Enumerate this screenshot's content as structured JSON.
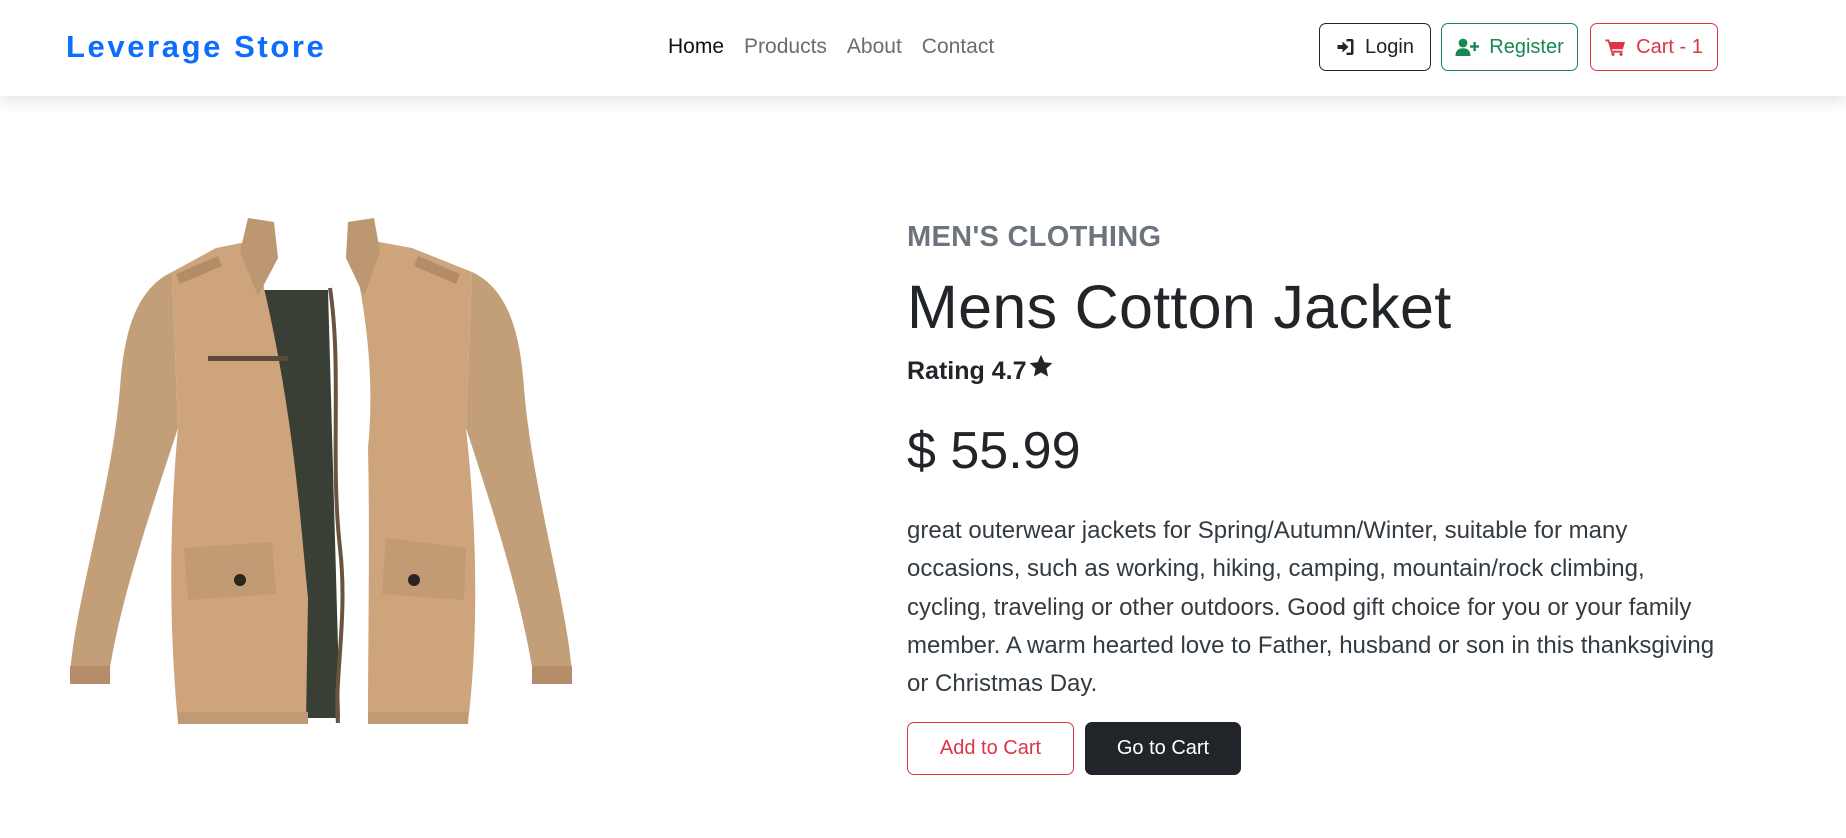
{
  "navbar": {
    "brand": "Leverage Store",
    "links": [
      {
        "label": "Home",
        "active": true
      },
      {
        "label": "Products",
        "active": false
      },
      {
        "label": "About",
        "active": false
      },
      {
        "label": "Contact",
        "active": false
      }
    ],
    "buttons": {
      "login": {
        "label": "Login",
        "icon": "sign-in-icon"
      },
      "register": {
        "label": "Register",
        "icon": "user-plus-icon"
      },
      "cart": {
        "label": "Cart - 1",
        "icon": "shopping-cart-icon"
      }
    }
  },
  "product": {
    "category": "MEN'S CLOTHING",
    "title": "Mens Cotton Jacket",
    "rating_label": "Rating 4.7",
    "rating_icon": "star-icon",
    "price": "$ 55.99",
    "description": "great outerwear jackets for Spring/Autumn/Winter, suitable for many occasions, such as working, hiking, camping, mountain/rock climbing, cycling, traveling or other outdoors. Good gift choice for you or your family member. A warm hearted love to Father, husband or son in this thanksgiving or Christmas Day.",
    "image": "jacket-product-image",
    "actions": {
      "add_to_cart": "Add to Cart",
      "go_to_cart": "Go to Cart"
    }
  },
  "colors": {
    "brand": "#0d6efd",
    "dark": "#212529",
    "success": "#198754",
    "danger": "#dc3545",
    "muted": "#6c757d",
    "jacket": "#c9a27a"
  }
}
